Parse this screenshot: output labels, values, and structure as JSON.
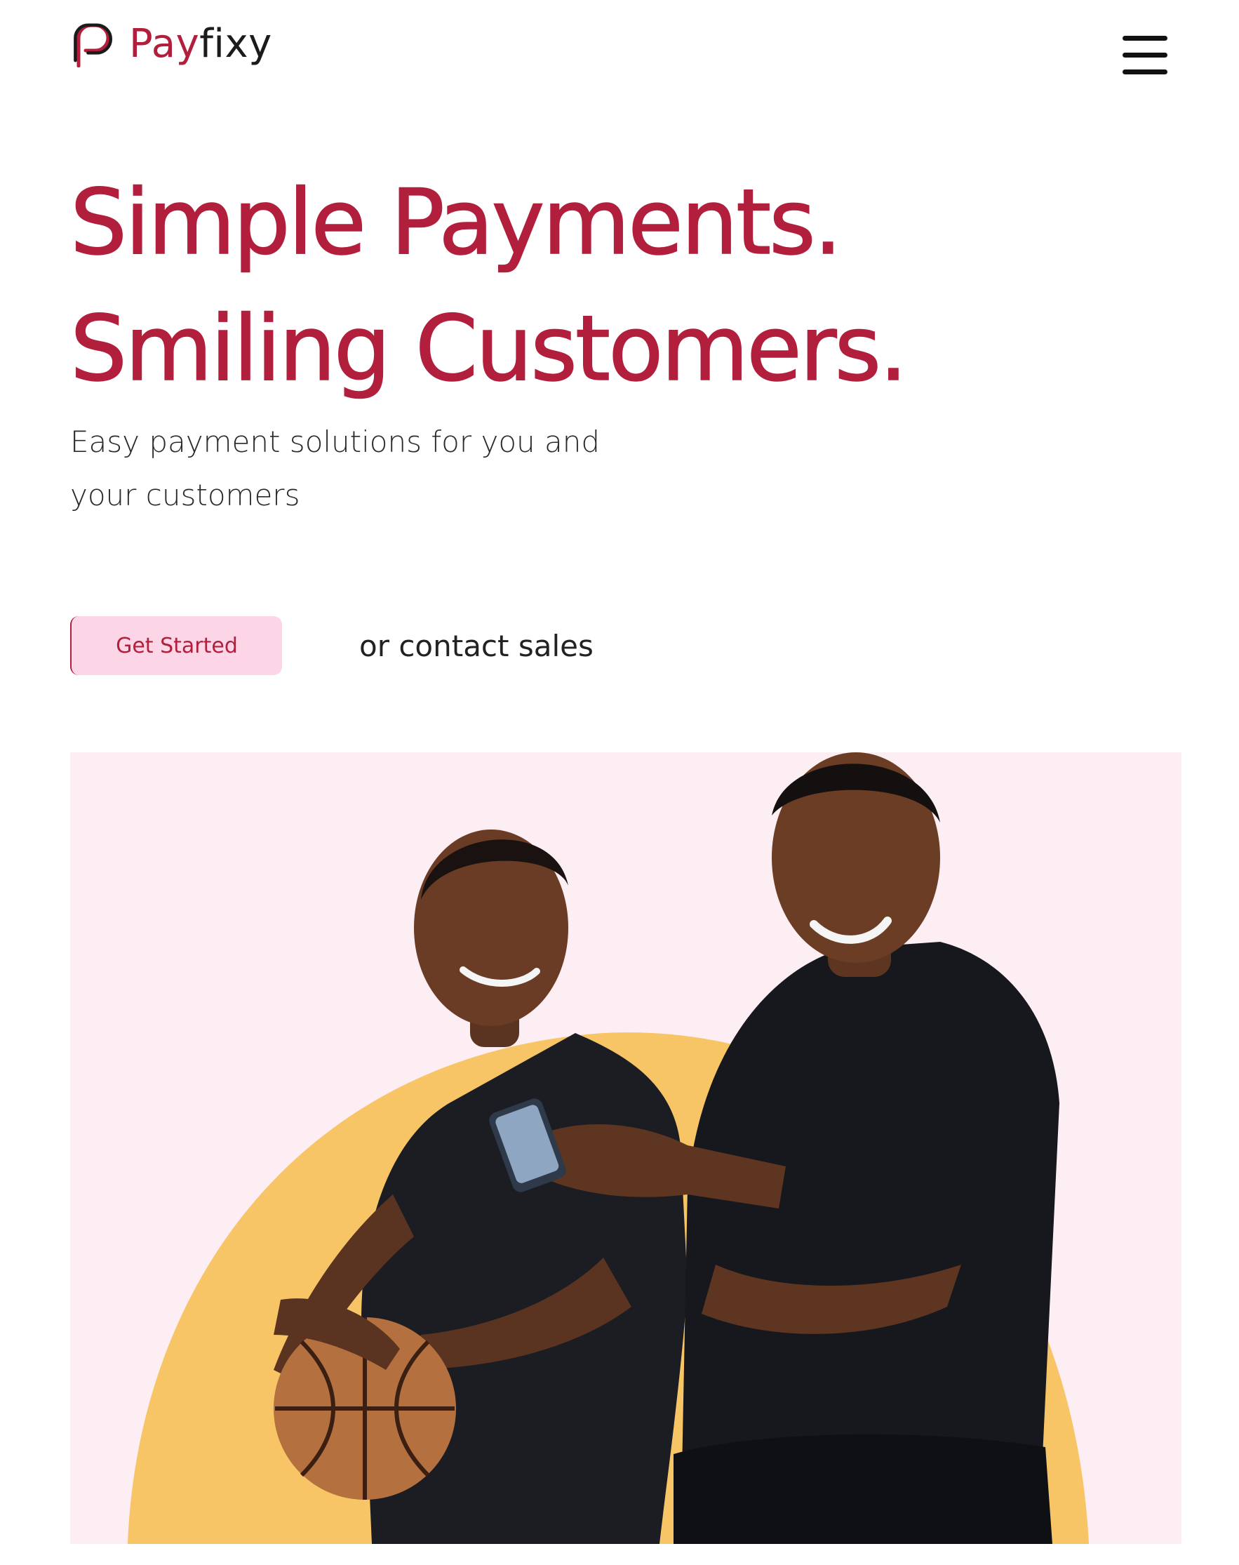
{
  "brand": {
    "name_part1": "Pay",
    "name_part2": "fixy",
    "primary_color": "#b21f3c",
    "cta_background": "#fcd6e6",
    "hero_background": "#fdeef4",
    "accent_color": "#f7c566"
  },
  "header": {
    "logo_icon": "payfixy-logo-icon",
    "menu_icon": "hamburger-menu-icon"
  },
  "hero": {
    "title_line1": "Simple Payments.",
    "title_line2": "Smiling Customers.",
    "subtitle_line1": "Easy payment solutions for you and",
    "subtitle_line2": "your customers",
    "cta_label": "Get Started",
    "contact_label": "or contact sales"
  },
  "image": {
    "description": "photo-two-smiling-men-with-phone-and-basketball"
  }
}
